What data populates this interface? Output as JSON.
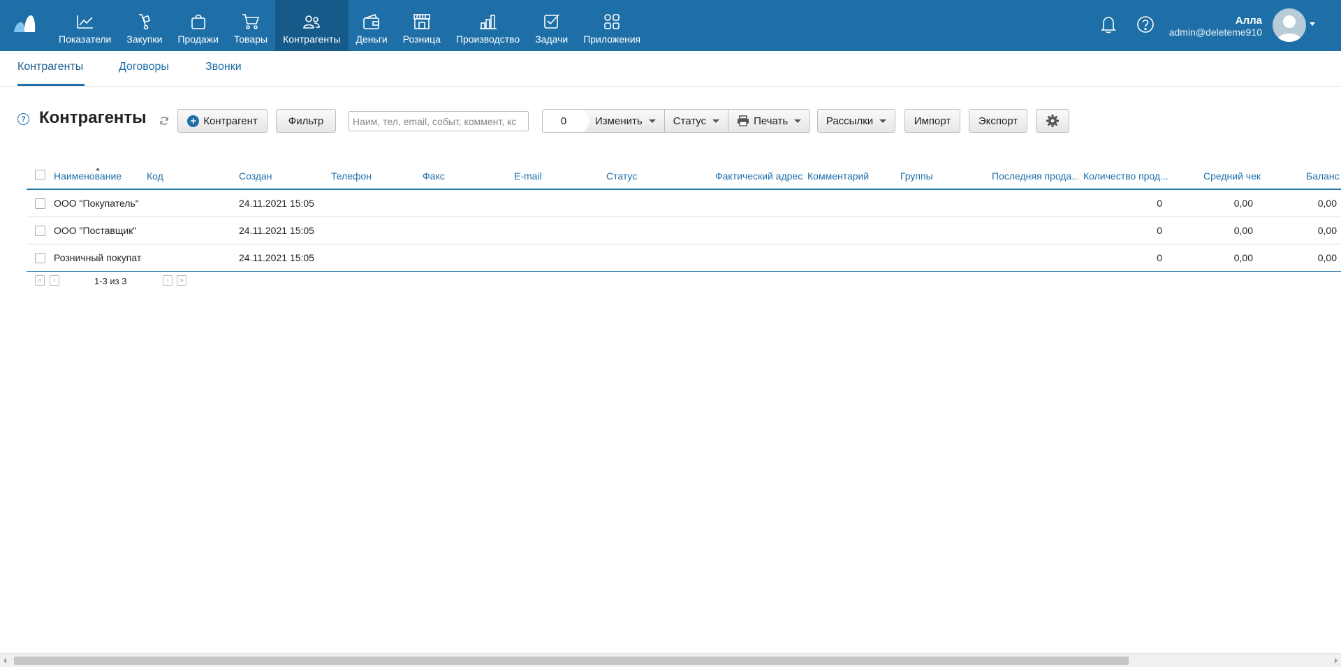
{
  "app": {
    "nav": [
      {
        "label": "Показатели",
        "icon": "chart-icon"
      },
      {
        "label": "Закупки",
        "icon": "hand-truck-icon"
      },
      {
        "label": "Продажи",
        "icon": "shopping-bag-icon"
      },
      {
        "label": "Товары",
        "icon": "cart-icon"
      },
      {
        "label": "Контрагенты",
        "icon": "contacts-icon",
        "active": true
      },
      {
        "label": "Деньги",
        "icon": "wallet-icon"
      },
      {
        "label": "Розница",
        "icon": "store-icon"
      },
      {
        "label": "Производство",
        "icon": "factory-icon"
      },
      {
        "label": "Задачи",
        "icon": "task-check-icon"
      },
      {
        "label": "Приложения",
        "icon": "apps-icon"
      }
    ],
    "user": {
      "name": "Алла",
      "email": "admin@deleteme910"
    }
  },
  "subtabs": [
    {
      "label": "Контрагенты",
      "active": true
    },
    {
      "label": "Договоры"
    },
    {
      "label": "Звонки"
    }
  ],
  "toolbar": {
    "help": "?",
    "title": "Контрагенты",
    "add_label": "Контрагент",
    "filter_label": "Фильтр",
    "search_placeholder": "Наим, тел, email, событ, коммент, кс",
    "selected_count": "0",
    "change_label": "Изменить",
    "status_label": "Статус",
    "print_label": "Печать",
    "mailing_label": "Рассылки",
    "import_label": "Импорт",
    "export_label": "Экспорт"
  },
  "table": {
    "columns": [
      "Наименование",
      "Код",
      "Создан",
      "Телефон",
      "Факс",
      "E-mail",
      "Статус",
      "Фактический адрес",
      "Комментарий",
      "Группы",
      "Последняя прода...",
      "Количество прод...",
      "Средний чек",
      "Баланс"
    ],
    "rows": [
      {
        "name": "ООО \"Покупатель\"",
        "created": "24.11.2021 15:05",
        "sales_count": "0",
        "avg_check": "0,00",
        "balance": "0,00"
      },
      {
        "name": "ООО \"Поставщик\"",
        "created": "24.11.2021 15:05",
        "sales_count": "0",
        "avg_check": "0,00",
        "balance": "0,00"
      },
      {
        "name": "Розничный покупатель",
        "created": "24.11.2021 15:05",
        "sales_count": "0",
        "avg_check": "0,00",
        "balance": "0,00"
      }
    ]
  },
  "pager": {
    "text": "1-3 из 3"
  },
  "colors": {
    "brand": "#1e6fa8",
    "active_nav": "#165a8a"
  }
}
